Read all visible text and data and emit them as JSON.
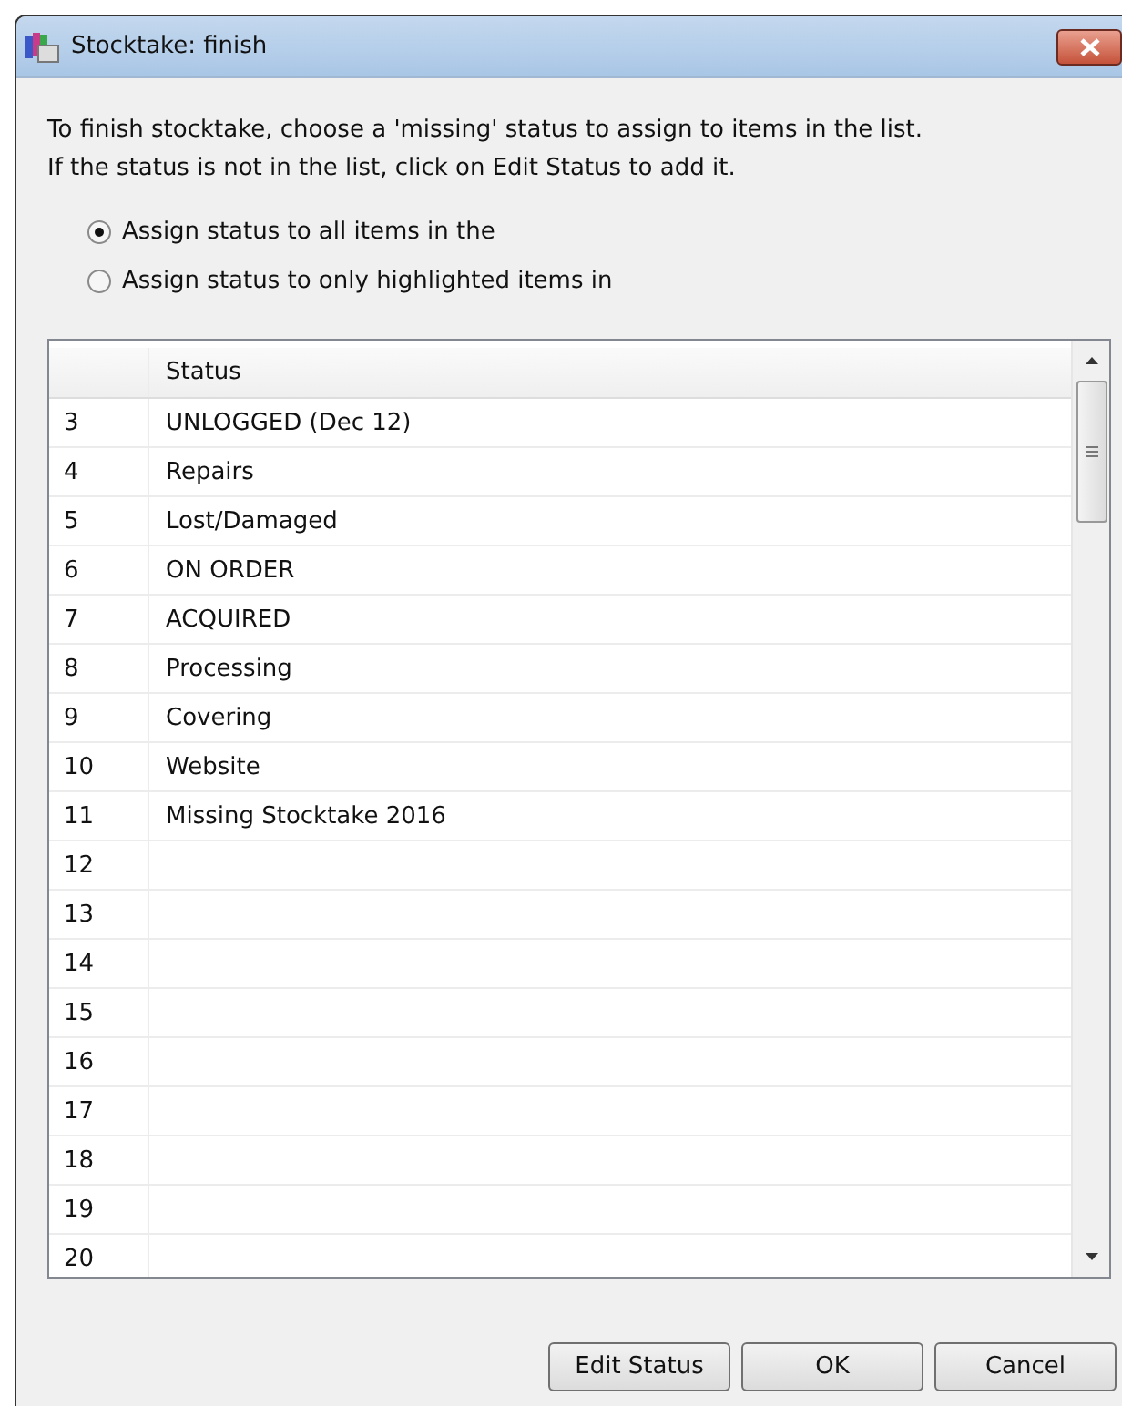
{
  "window": {
    "title": "Stocktake: finish"
  },
  "instructions": "To finish stocktake, choose a 'missing' status to assign to items in the list.\nIf the status is not in the list, click on Edit Status to add it.",
  "options": [
    {
      "label": "Assign status to all items in the",
      "selected": true
    },
    {
      "label": "Assign status to only highlighted items in",
      "selected": false
    }
  ],
  "table": {
    "columns": [
      "",
      "Status"
    ],
    "rows": [
      {
        "number": "3",
        "status": "UNLOGGED (Dec 12)"
      },
      {
        "number": "4",
        "status": "Repairs"
      },
      {
        "number": "5",
        "status": "Lost/Damaged"
      },
      {
        "number": "6",
        "status": "ON ORDER"
      },
      {
        "number": "7",
        "status": "ACQUIRED"
      },
      {
        "number": "8",
        "status": "Processing"
      },
      {
        "number": "9",
        "status": "Covering"
      },
      {
        "number": "10",
        "status": "Website"
      },
      {
        "number": "11",
        "status": "Missing Stocktake 2016"
      },
      {
        "number": "12"
      },
      {
        "number": "13"
      },
      {
        "number": "14"
      },
      {
        "number": "15"
      },
      {
        "number": "16"
      },
      {
        "number": "17"
      },
      {
        "number": "18"
      },
      {
        "number": "19"
      },
      {
        "number": "20"
      }
    ]
  },
  "buttons": [
    "Edit Status",
    "OK",
    "Cancel"
  ]
}
